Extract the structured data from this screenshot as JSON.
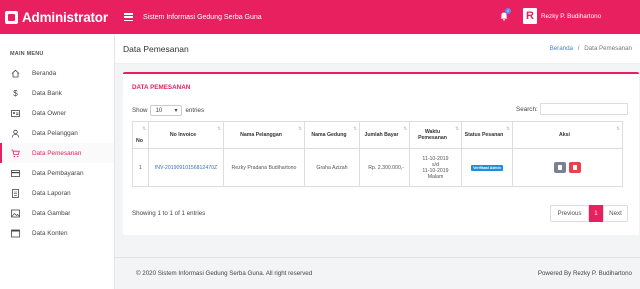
{
  "brand": {
    "title": "Administrator",
    "logo_icon": "square-logo-icon"
  },
  "topbar": {
    "system_name": "Sistem Informasi Gedung Serba Guna",
    "notif_count": "4",
    "user_initial": "R",
    "user_name": "Rezky P. Budihartono"
  },
  "colors": {
    "accent": "#e8205f",
    "link": "#3a6fb5",
    "badge": "#1f8ed8",
    "delete": "#e8424b"
  },
  "sidebar": {
    "heading": "MAIN MENU",
    "items": [
      {
        "label": "Beranda",
        "icon": "home-icon"
      },
      {
        "label": "Data Bank",
        "icon": "dollar-icon"
      },
      {
        "label": "Data Owner",
        "icon": "id-card-icon"
      },
      {
        "label": "Data Pelanggan",
        "icon": "user-icon"
      },
      {
        "label": "Data Pemesanan",
        "icon": "cart-icon",
        "active": true
      },
      {
        "label": "Data Pembayaran",
        "icon": "credit-card-icon"
      },
      {
        "label": "Data Laporan",
        "icon": "report-icon"
      },
      {
        "label": "Data Gambar",
        "icon": "image-icon"
      },
      {
        "label": "Data Konten",
        "icon": "window-icon"
      }
    ]
  },
  "header": {
    "title": "Data Pemesanan",
    "breadcrumb_home": "Beranda",
    "breadcrumb_sep": "/",
    "breadcrumb_current": "Data Pemesanan"
  },
  "card": {
    "title": "DATA PEMESANAN",
    "show_label": "Show",
    "show_value": "10",
    "entries_label": "entries",
    "search_label": "Search:"
  },
  "table": {
    "headers": [
      "No",
      "No Invoice",
      "Nama Pelanggan",
      "Nama Gedung",
      "Jumlah Bayar",
      "Waktu Pemesanan",
      "Status Pesanan",
      "Aksi"
    ],
    "rows": [
      {
        "no": "1",
        "invoice": "INV-20190910156812470Z",
        "pelanggan": "Rezky Pradana Budihartono",
        "gedung": "Graha Azizah",
        "jumlah": "Rp. 2.300.000,-",
        "waktu_1": "11-10-2019",
        "waktu_2": "s/d",
        "waktu_3": "11-10-2019",
        "waktu_4": "Malam",
        "status": "Verifikasi Admin"
      }
    ]
  },
  "pagination": {
    "info": "Showing 1 to 1 of 1 entries",
    "prev": "Previous",
    "current": "1",
    "next": "Next"
  },
  "footer": {
    "left": "© 2020 Sistem Informasi Gedung Serba Guna. All right reserved",
    "right": "Powered By Rezky P. Budihartono"
  }
}
